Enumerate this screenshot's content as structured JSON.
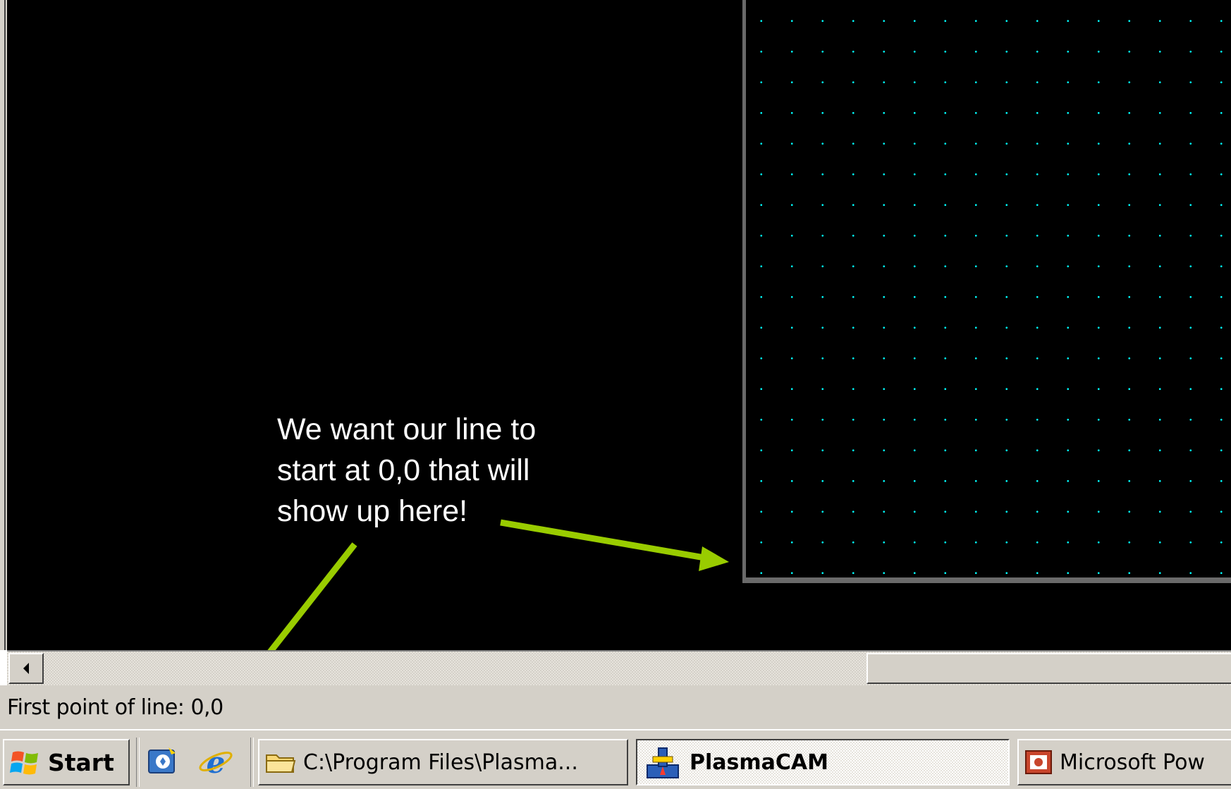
{
  "canvas": {
    "annotation_text": "We want our line to start at 0,0 that will show up here!",
    "grid_dot_color": "#00ffff",
    "arrow_color": "#99cc00"
  },
  "status_bar": {
    "text": "First point of line: 0,0"
  },
  "taskbar": {
    "start_label": "Start",
    "quick_launch": [
      {
        "icon": "outlook-express-icon"
      },
      {
        "icon": "internet-explorer-icon"
      }
    ],
    "windows": [
      {
        "label": "C:\\Program Files\\Plasma...",
        "icon": "folder-icon",
        "active": false
      },
      {
        "label": "PlasmaCAM",
        "icon": "plasmacam-icon",
        "active": true
      },
      {
        "label": "Microsoft Pow",
        "icon": "powerpoint-icon",
        "active": false
      }
    ]
  }
}
